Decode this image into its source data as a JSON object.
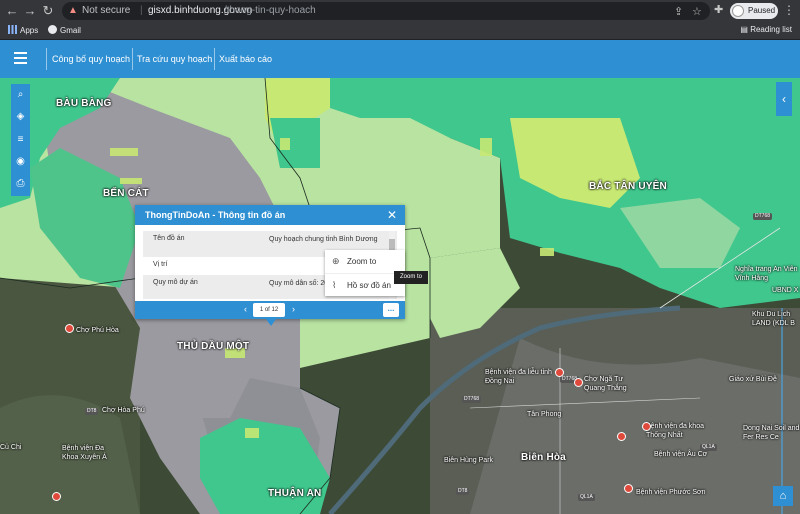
{
  "browser": {
    "security_label": "Not secure",
    "url_host": "gisxd.binhduong.gov.vn",
    "url_path": "/thong-tin-quy-hoach",
    "profile_status": "Paused",
    "bookmarks": [
      {
        "label": "Apps"
      },
      {
        "label": "Gmail"
      }
    ],
    "reading_list": "Reading list"
  },
  "appbar": {
    "menu": [
      {
        "label": "Công bố quy hoạch"
      },
      {
        "label": "Tra cứu quy hoạch"
      },
      {
        "label": "Xuất báo cáo"
      }
    ]
  },
  "map": {
    "places": [
      {
        "name": "BÀU BÀNG"
      },
      {
        "name": "BẾN CÁT"
      },
      {
        "name": "BẮC TÂN UYÊN"
      },
      {
        "name": "THỦ DẦU MỘT"
      },
      {
        "name": "THUẬN AN"
      },
      {
        "name": "Biên Hòa"
      }
    ],
    "pois": [
      "Chợ Phú Hòa",
      "Chợ Hòa Phú",
      "Bệnh viện đa liễu tỉnh Đồng Nai",
      "Chợ Ngã Tư Quang Thắng",
      "Bệnh viện đa khoa Thống Nhất",
      "Bệnh viện Đa Khoa Xuyên Á",
      "Biên Hùng Park",
      "Nghĩa trang An Viên Vĩnh Hằng",
      "UBND X Lu",
      "Giáo xứ Bùi Đệ",
      "Bệnh viện Âu Cơ",
      "Dong Nai Soil and Fer Res Ce",
      "Bệnh viện Phước Sơn",
      "Khu Du Lịch LAND (KDL B",
      "Củ Chi",
      "Tân Phong"
    ],
    "roads": [
      "DT768",
      "DT768",
      "DT768",
      "DT8",
      "DT8",
      "QL1A",
      "QL1A"
    ]
  },
  "popup": {
    "title": "ThongTinDoAn - Thông tin đồ án",
    "rows": [
      {
        "key": "Tên đồ án",
        "value": "Quy hoạch chung tỉnh Bình Dương"
      },
      {
        "key": "Vị trí",
        "value": ""
      },
      {
        "key": "Quy mô dự án",
        "value": "Quy mô dân số: 2020) và 3.5 triệu"
      }
    ],
    "pager": "1 of 12",
    "more_label": "..."
  },
  "context_menu": {
    "items": [
      {
        "label": "Zoom to"
      },
      {
        "label": "Hồ sơ đồ án"
      }
    ],
    "tooltip": "Zoom to"
  },
  "colors": {
    "brand_blue": "#2e8fd3",
    "zone_green": "#3fc78d",
    "zone_lightgreen": "#b8e3a1",
    "zone_gray": "#9a9aa0",
    "zone_yellowgreen": "#c7e873"
  }
}
